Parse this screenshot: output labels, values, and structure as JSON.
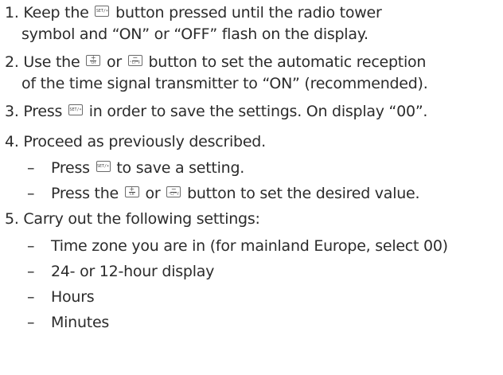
{
  "buttons": {
    "set": {
      "label": "SET/☀",
      "icon": "set-light-button-icon"
    },
    "ch": {
      "symbol": "+",
      "label": "CH",
      "icon": "plus-ch-button-icon"
    },
    "cf": {
      "symbol": "−",
      "label": "°C/°F",
      "icon": "minus-cf-button-icon"
    }
  },
  "steps": [
    {
      "line1_a": "1. Keep the ",
      "line1_b": " button pressed until the radio tower",
      "line2": "symbol and “ON” or “OFF” flash on the display."
    },
    {
      "line1_a": "2. Use the ",
      "line1_b": " or ",
      "line1_c": " button to set the automatic reception",
      "line2": "of the time signal transmitter to “ON” (recommended)."
    },
    {
      "line1_a": "3. Press ",
      "line1_b": " in order to save the settings. On display “00”."
    },
    {
      "line1": "4. Proceed as previously described.",
      "sub": [
        {
          "a": "–",
          "b": "Press ",
          "c": " to save a setting."
        },
        {
          "a": "–",
          "b": "Press the ",
          "c": " or ",
          "d": " button to set the desired value."
        }
      ]
    },
    {
      "line1": "5. Carry out the following settings:",
      "sub": [
        {
          "a": "–",
          "b": "Time zone you are in (for mainland Europe, select 00)"
        },
        {
          "a": "–",
          "b": "24- or 12-hour display"
        },
        {
          "a": "–",
          "b": "Hours"
        },
        {
          "a": "–",
          "b": "Minutes"
        }
      ]
    }
  ]
}
